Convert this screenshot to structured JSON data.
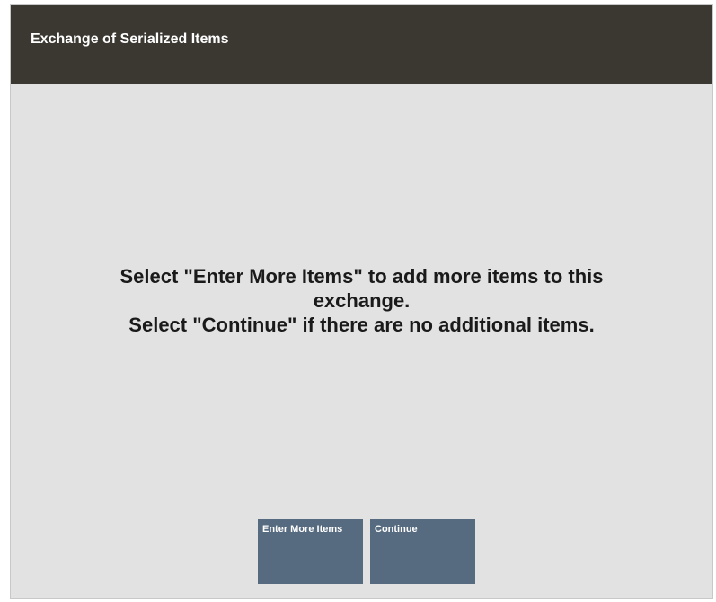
{
  "window": {
    "title": "Exchange of Serialized Items"
  },
  "message": {
    "line1": "Select \"Enter More Items\" to add more items to this",
    "line2": "exchange.",
    "line3": "Select \"Continue\" if there are no additional items."
  },
  "buttons": {
    "enter_more_items": "Enter More Items",
    "continue": "Continue"
  },
  "colors": {
    "title_bar": "#3b3731",
    "background": "#e2e2e2",
    "button": "#566a80"
  }
}
